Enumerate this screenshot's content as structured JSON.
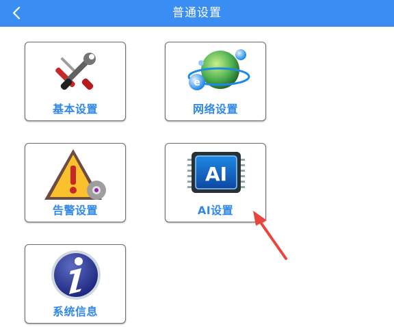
{
  "header": {
    "title": "普通设置"
  },
  "tiles": [
    {
      "label": "基本设置",
      "icon": "tools-icon"
    },
    {
      "label": "网络设置",
      "icon": "globe-network-icon"
    },
    {
      "label": "告警设置",
      "icon": "alarm-warning-icon"
    },
    {
      "label": "AI设置",
      "icon": "ai-chip-icon"
    },
    {
      "label": "系统信息",
      "icon": "info-icon"
    }
  ],
  "colors": {
    "header": "#3a8ef3",
    "label": "#2f87e8",
    "arrow": "#e8463c"
  }
}
